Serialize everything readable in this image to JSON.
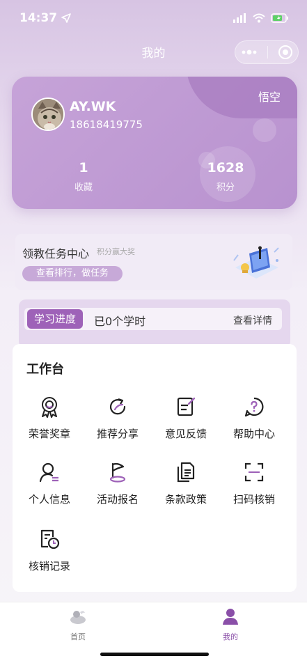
{
  "status_bar": {
    "time": "14:37"
  },
  "nav": {
    "title": "我的"
  },
  "profile": {
    "name": "AY.WK",
    "phone": "18618419775",
    "level": "悟空",
    "stats": {
      "favorites": {
        "value": "1",
        "label": "收藏"
      },
      "points": {
        "value": "1628",
        "label": "积分"
      }
    }
  },
  "task_center": {
    "title": "领教任务中心",
    "subtitle": "积分赢大奖",
    "button": "查看排行，做任务"
  },
  "progress": {
    "tag": "学习进度",
    "hours": "已0个学时",
    "detail": "查看详情"
  },
  "workbench": {
    "title": "工作台",
    "items": [
      {
        "label": "荣誉奖章",
        "icon": "medal-icon"
      },
      {
        "label": "推荐分享",
        "icon": "share-icon"
      },
      {
        "label": "意见反馈",
        "icon": "feedback-icon"
      },
      {
        "label": "帮助中心",
        "icon": "help-icon"
      },
      {
        "label": "个人信息",
        "icon": "user-info-icon"
      },
      {
        "label": "活动报名",
        "icon": "flag-icon"
      },
      {
        "label": "条款政策",
        "icon": "policy-icon"
      },
      {
        "label": "扫码核销",
        "icon": "scan-icon"
      },
      {
        "label": "核销记录",
        "icon": "record-icon"
      }
    ]
  },
  "tabbar": {
    "home": "首页",
    "mine": "我的"
  },
  "colors": {
    "accent": "#9e62b8",
    "card": "#c0a0d4"
  }
}
